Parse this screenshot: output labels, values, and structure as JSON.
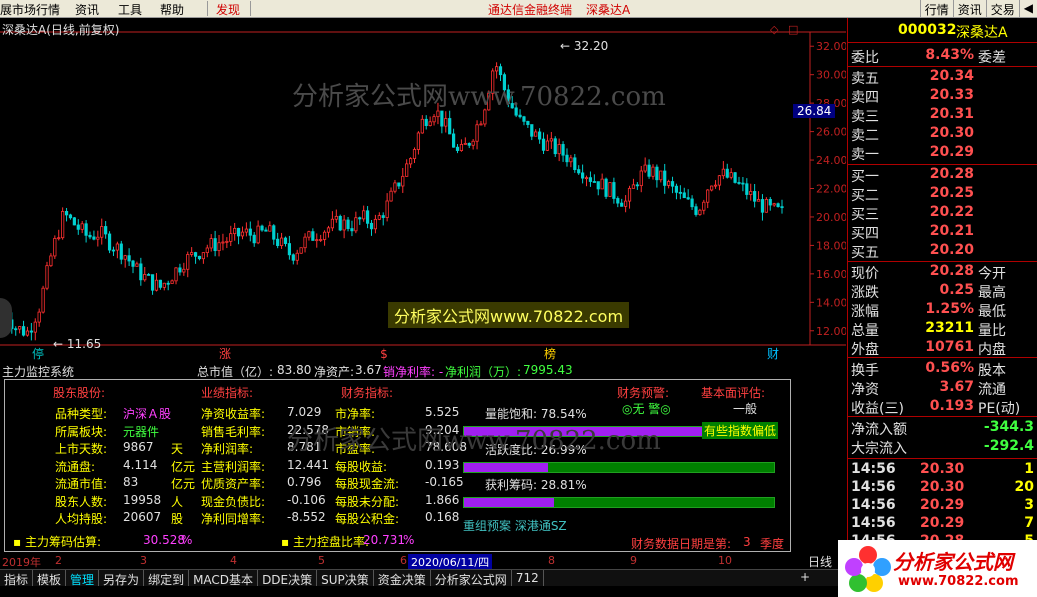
{
  "menu": {
    "items": [
      "展市场行情",
      "资讯",
      "工具",
      "帮助",
      "发现"
    ],
    "center_title": "通达信金融终端",
    "center_stock": "深桑达A",
    "right_buttons": [
      "行情",
      "资讯",
      "交易"
    ]
  },
  "chart": {
    "title": "深桑达A(日线,前复权)",
    "watermark_top": "分析家公式网www.70822.com",
    "watermark_center": "分析家公式网www.70822.com",
    "watermark_panel": "分析家公式网www.70822.com",
    "high_label": "32.20",
    "low_label": "11.65",
    "current_price_tag": "26.84",
    "markers": [
      "停",
      "涨",
      "$",
      "榜",
      "财"
    ]
  },
  "chart_data": {
    "type": "candlestick",
    "ylim": [
      11,
      33
    ],
    "yticks": [
      "32.00",
      "30.00",
      "28.00",
      "26.00",
      "24.00",
      "22.00",
      "20.00",
      "18.00",
      "16.00",
      "14.00",
      "12.00"
    ],
    "x_period_labels": [
      "2019年",
      "2",
      "3",
      "4",
      "5",
      "6",
      "7",
      "2020/06/11/四",
      "8",
      "9",
      "10"
    ],
    "close_path": [
      13.5,
      12.2,
      11.9,
      13.8,
      17.5,
      20.2,
      19.4,
      18.6,
      18.9,
      18.1,
      17.5,
      16.3,
      15.6,
      15.0,
      15.9,
      16.9,
      17.4,
      17.9,
      18.2,
      18.5,
      18.9,
      18.7,
      19.0,
      18.2,
      17.3,
      18.2,
      18.8,
      19.2,
      19.6,
      19.4,
      19.9,
      19.5,
      20.8,
      22.5,
      24.2,
      26.8,
      27.6,
      26.2,
      24.3,
      25.5,
      27.3,
      31.0,
      28.5,
      26.8,
      26.0,
      25.3,
      24.8,
      24.3,
      23.6,
      22.8,
      22.2,
      21.6,
      21.0,
      22.8,
      23.3,
      22.6,
      21.8,
      21.0,
      20.5,
      22.5,
      23.0,
      22.5,
      21.8,
      21.0,
      20.5,
      20.3
    ]
  },
  "info_strip": {
    "name": "主力监控系统",
    "mcap_label": "总市值（亿）: ",
    "mcap_value": "83.80",
    "net_asset_label": "净资产: ",
    "net_asset_value": "3.67",
    "net_margin_label": "销净利率: -",
    "net_profit_label": "净利润（万）: ",
    "net_profit_value": "7995.43"
  },
  "panel": {
    "headers": {
      "stock": "股东股份:",
      "business": "业绩指标:",
      "finance": "财务指标:",
      "warning": "财务预警:",
      "fundamental": "基本面评估:"
    },
    "stock_rows": [
      {
        "label": "品种类型:",
        "value": "沪深Ａ股",
        "unit": ""
      },
      {
        "label": "所属板块:",
        "value": "元器件",
        "unit": ""
      },
      {
        "label": "上市天数:",
        "value": "9867",
        "unit": "天"
      },
      {
        "label": "流通盘:",
        "value": "4.114",
        "unit": "亿元"
      },
      {
        "label": "流通市值:",
        "value": "83",
        "unit": "亿元"
      },
      {
        "label": "股东人数:",
        "value": "19958",
        "unit": "人"
      },
      {
        "label": "人均持股:",
        "value": "20607",
        "unit": "股"
      }
    ],
    "business_rows": [
      {
        "label": "净资收益率:",
        "value": "7.029"
      },
      {
        "label": "销售毛利率:",
        "value": "22.578"
      },
      {
        "label": "净利润率:",
        "value": "8.781"
      },
      {
        "label": "主营利润率:",
        "value": "12.441"
      },
      {
        "label": "优质资产率:",
        "value": "0.796"
      },
      {
        "label": "现金负债比:",
        "value": "-0.106"
      },
      {
        "label": "净利同增率:",
        "value": "-8.552"
      }
    ],
    "finance_rows": [
      {
        "label": "市净率:",
        "value": "5.525"
      },
      {
        "label": "市销率:",
        "value": "9.204"
      },
      {
        "label": "市盈率:",
        "value": "78.608"
      },
      {
        "label": "每股收益:",
        "value": "0.193"
      },
      {
        "label": "每股现金流:",
        "value": "-0.165"
      },
      {
        "label": "每股未分配:",
        "value": "1.866"
      },
      {
        "label": "每股公积金:",
        "value": "0.168"
      }
    ],
    "warning_value": "◎无 警◎",
    "fundamental_value": "一般",
    "fundamental_note": "有些指数偏低",
    "meters": [
      {
        "label": "量能饱和:",
        "value": "78.54",
        "unit": "%",
        "fraction": 0.79
      },
      {
        "label": "活跃度比:",
        "value": "26.99",
        "unit": "%",
        "fraction": 0.27
      },
      {
        "label": "获利筹码:",
        "value": "28.81",
        "unit": "%",
        "fraction": 0.29
      }
    ],
    "concepts": "重组预案 深港通SZ",
    "main_chip_label": "主力筹码估算:",
    "main_chip_value": "30.528",
    "main_chip_unit": "%",
    "main_ctrl_label": "主力控盘比率:",
    "main_ctrl_value": "20.731",
    "main_ctrl_unit": "%",
    "report_label": "财务数据日期是第:",
    "report_value": "3",
    "report_unit": "季度"
  },
  "bottom_tabs": [
    "指标",
    "模板",
    "管理",
    "另存为",
    "绑定到",
    "MACD基本",
    "DDE决策",
    "SUP决策",
    "资金决策",
    "分析家公式网",
    "712"
  ],
  "bottom_right": "日线",
  "quote": {
    "code": "000032",
    "name": "深桑达A",
    "weibi_label": "委比",
    "weibi_value": "8.43%",
    "weicha_label": "委差",
    "asks": [
      {
        "label": "卖五",
        "price": "20.34"
      },
      {
        "label": "卖四",
        "price": "20.33"
      },
      {
        "label": "卖三",
        "price": "20.31"
      },
      {
        "label": "卖二",
        "price": "20.30"
      },
      {
        "label": "卖一",
        "price": "20.29"
      }
    ],
    "bids": [
      {
        "label": "买一",
        "price": "20.28"
      },
      {
        "label": "买二",
        "price": "20.25"
      },
      {
        "label": "买三",
        "price": "20.22"
      },
      {
        "label": "买四",
        "price": "20.21"
      },
      {
        "label": "买五",
        "price": "20.20"
      }
    ],
    "stats": [
      {
        "label": "现价",
        "value": "20.28",
        "right": "今开",
        "color": "r"
      },
      {
        "label": "涨跌",
        "value": "0.25",
        "right": "最高",
        "color": "r"
      },
      {
        "label": "涨幅",
        "value": "1.25%",
        "right": "最低",
        "color": "r"
      },
      {
        "label": "总量",
        "value": "23211",
        "right": "量比",
        "color": "y"
      },
      {
        "label": "外盘",
        "value": "10761",
        "right": "内盘",
        "color": "r"
      }
    ],
    "stats2": [
      {
        "label": "换手",
        "value": "0.56%",
        "right": "股本"
      },
      {
        "label": "净资",
        "value": "3.67",
        "right": "流通"
      },
      {
        "label": "收益(三)",
        "value": "0.193",
        "right": "PE(动)"
      }
    ],
    "flow": [
      {
        "label": "净流入额",
        "value": "-344.3"
      },
      {
        "label": "大宗流入",
        "value": "-292.4"
      }
    ],
    "ticks": [
      {
        "time": "14:56",
        "price": "20.30",
        "vol": "1"
      },
      {
        "time": "14:56",
        "price": "20.30",
        "vol": "20"
      },
      {
        "time": "14:56",
        "price": "20.29",
        "vol": "3"
      },
      {
        "time": "14:56",
        "price": "20.29",
        "vol": "7"
      },
      {
        "time": "14:56",
        "price": "20.28",
        "vol": "5"
      }
    ]
  },
  "ad": {
    "text": "分析家公式网",
    "url": "www.70822.com"
  }
}
